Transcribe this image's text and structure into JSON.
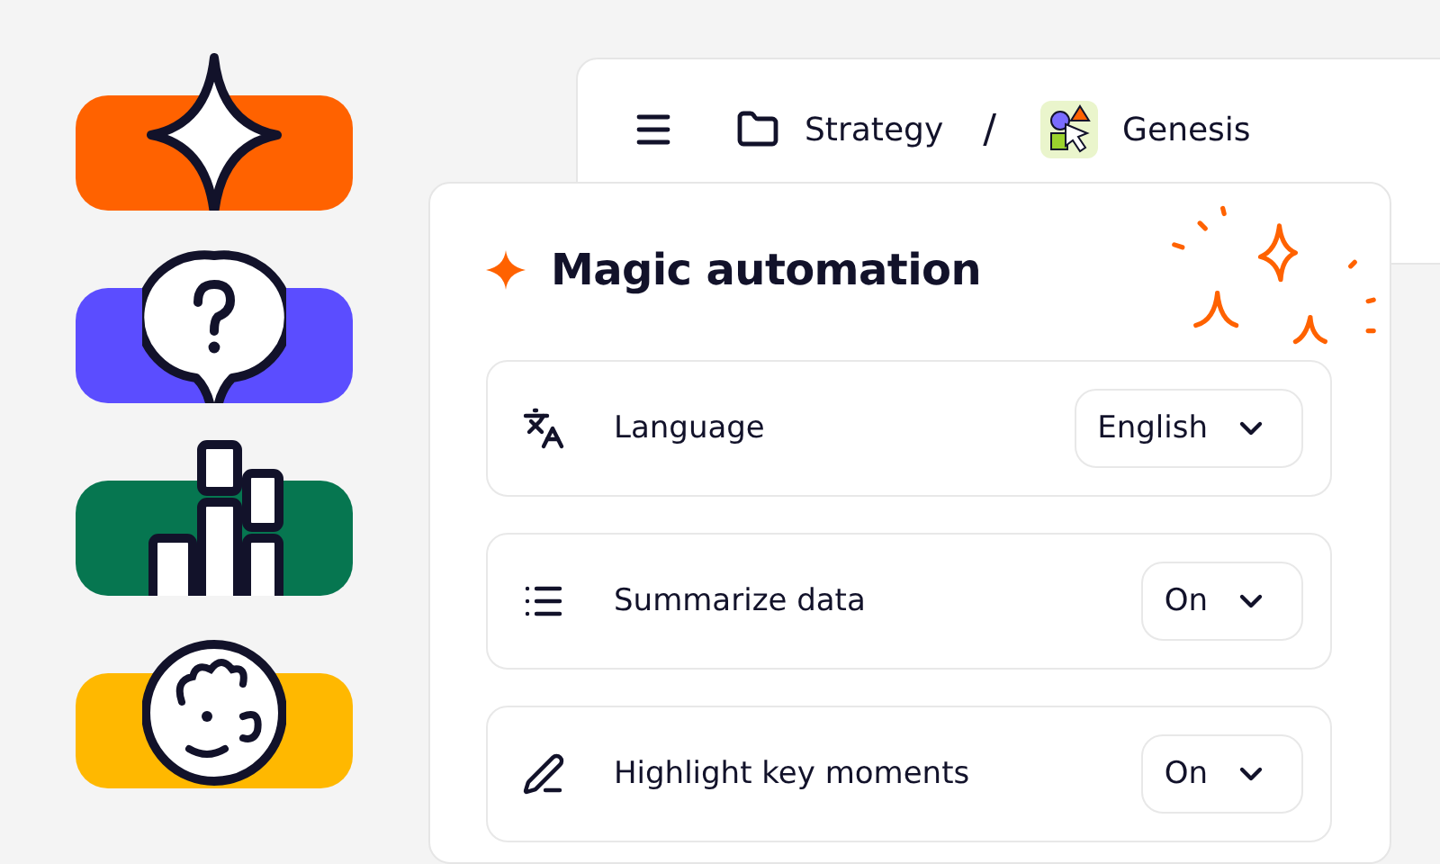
{
  "badges": [
    {
      "kind": "sparkle",
      "color": "#ff6200"
    },
    {
      "kind": "question",
      "color": "#5b4dff"
    },
    {
      "kind": "chart",
      "color": "#067650"
    },
    {
      "kind": "face",
      "color": "#ffb800"
    }
  ],
  "header": {
    "folder": "Strategy",
    "separator": "/",
    "project": "Genesis"
  },
  "panel": {
    "title": "Magic automation",
    "settings": [
      {
        "kind": "language",
        "label": "Language",
        "value": "English"
      },
      {
        "kind": "list",
        "label": "Summarize data",
        "value": "On"
      },
      {
        "kind": "pen",
        "label": "Highlight key moments",
        "value": "On"
      }
    ]
  }
}
